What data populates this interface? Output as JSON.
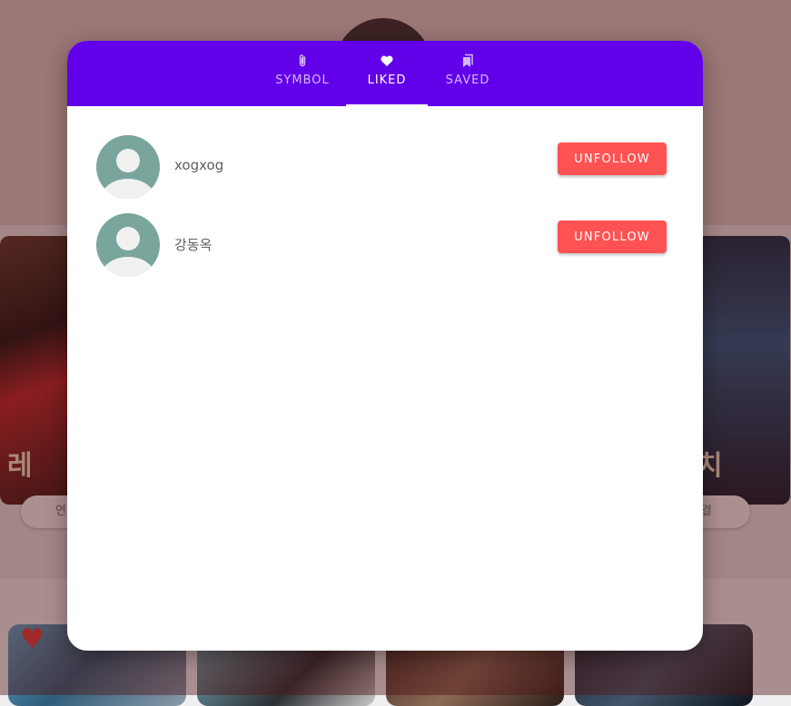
{
  "tabs": [
    {
      "label": "SYMBOL",
      "icon": "paperclip-icon",
      "active": false
    },
    {
      "label": "LIKED",
      "icon": "heart-icon",
      "active": true
    },
    {
      "label": "SAVED",
      "icon": "bookmarks-icon",
      "active": false
    }
  ],
  "users": [
    {
      "name": "xogxog",
      "action": "UNFOLLOW"
    },
    {
      "name": "강동옥",
      "action": "UNFOLLOW"
    }
  ],
  "background": {
    "poster_left_text": "레",
    "poster_right_text": "치",
    "pill_left": "연",
    "pill_right": "결"
  },
  "colors": {
    "tab_bar": "#6200ea",
    "unfollow_button": "#ff5252",
    "avatar": "#79a59d"
  }
}
